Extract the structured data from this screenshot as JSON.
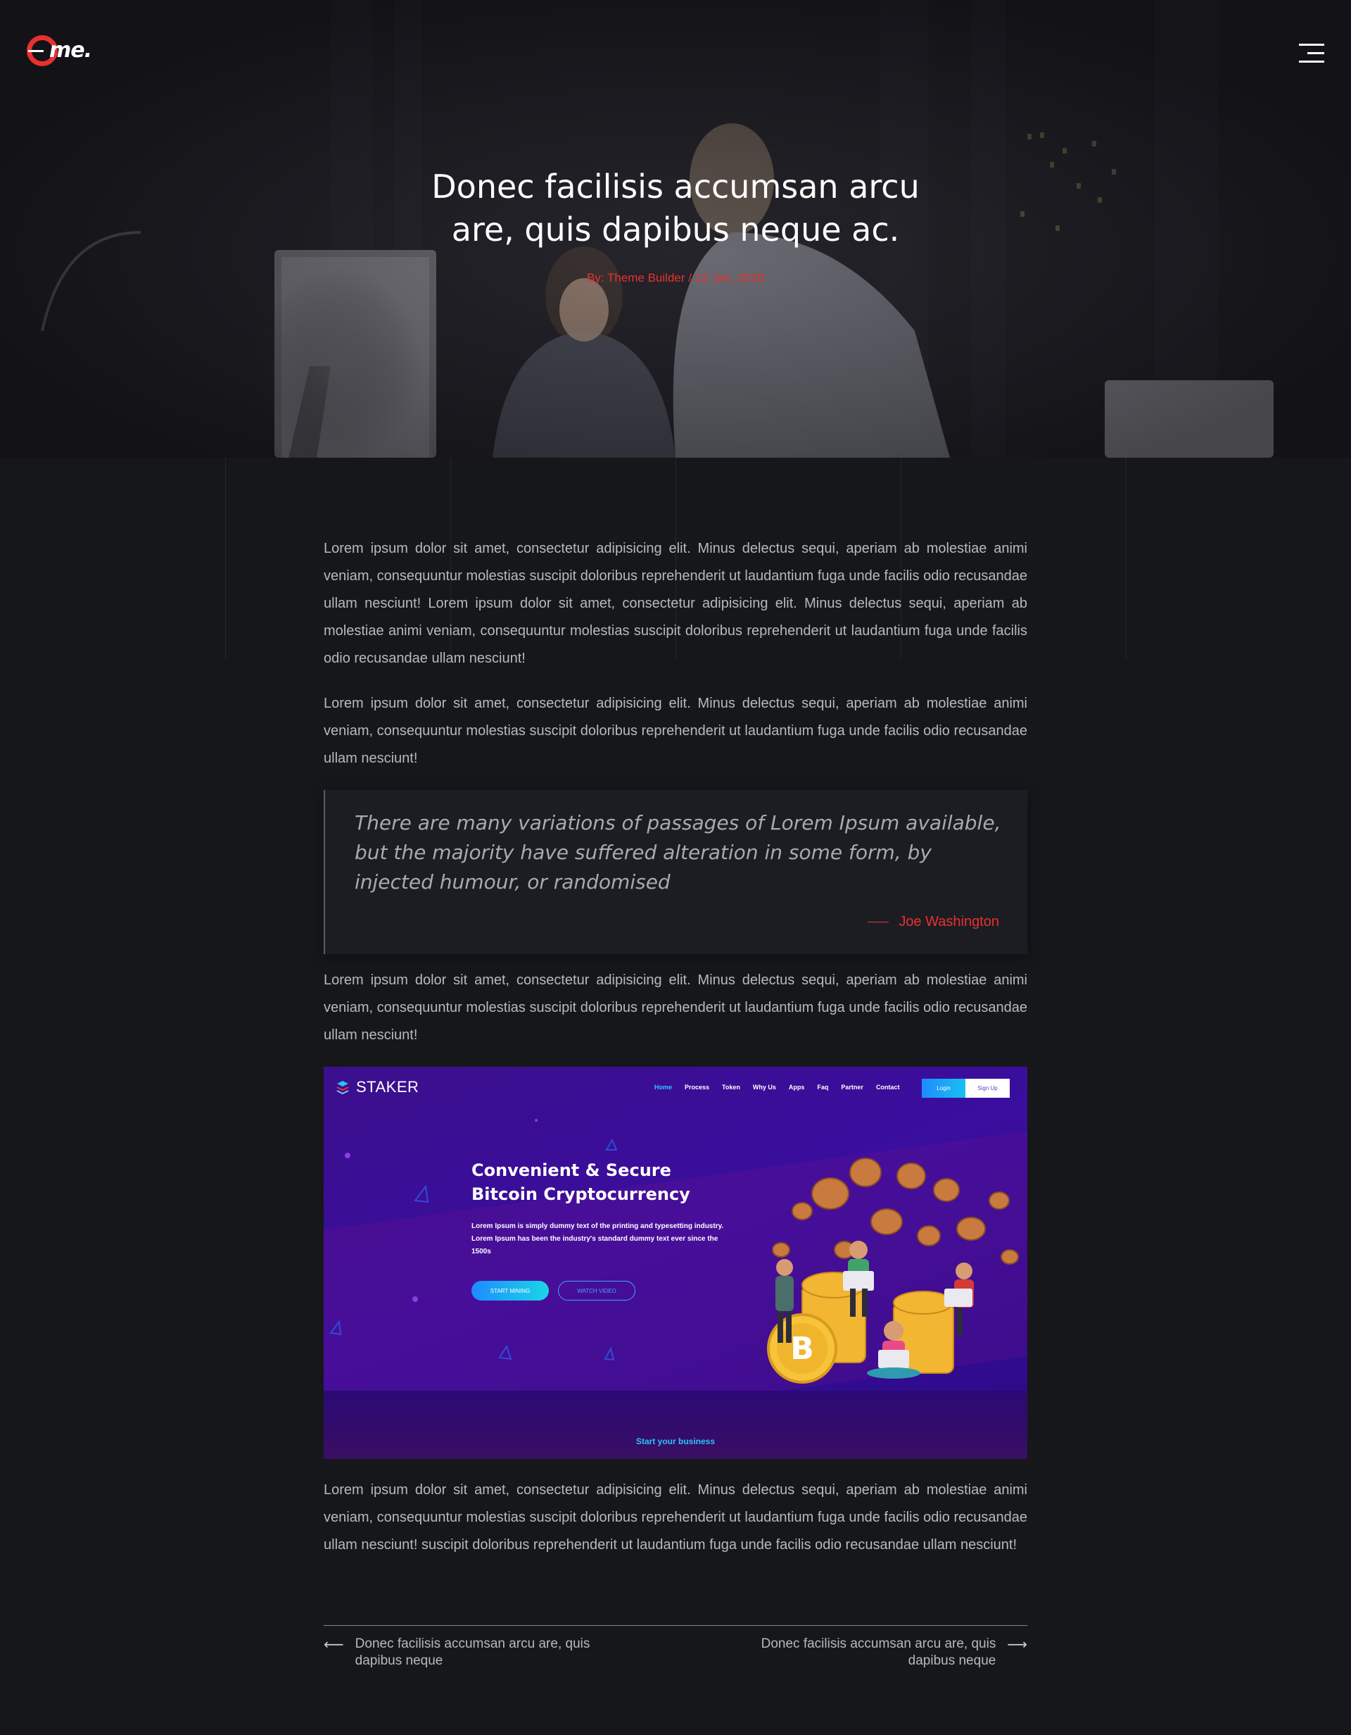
{
  "header": {
    "logo_text": "me.",
    "menu_icon": "hamburger-menu-icon"
  },
  "hero": {
    "title_line1": "Donec facilisis accumsan arcu",
    "title_line2": "are, quis dapibus neque ac.",
    "meta": "By: Theme Builder / 12 Jan, 2020"
  },
  "article": {
    "paragraph1": "Lorem ipsum dolor sit amet, consectetur adipisicing elit. Minus delectus sequi, aperiam ab molestiae animi veniam, consequuntur molestias suscipit doloribus reprehenderit ut laudantium fuga unde facilis odio recusandae ullam nesciunt! Lorem ipsum dolor sit amet, consectetur adipisicing elit. Minus delectus sequi, aperiam ab molestiae animi veniam, consequuntur molestias suscipit doloribus reprehenderit ut laudantium fuga unde facilis odio recusandae ullam nesciunt!",
    "paragraph2": "Lorem ipsum dolor sit amet, consectetur adipisicing elit. Minus delectus sequi, aperiam ab molestiae animi veniam, consequuntur molestias suscipit doloribus reprehenderit ut laudantium fuga unde facilis odio recusandae ullam nesciunt!",
    "quote": {
      "text": "There are many variations of passages of Lorem Ipsum available, but the majority have suffered alteration in some form, by injected humour, or randomised",
      "author": "Joe Washington"
    },
    "paragraph3": "Lorem ipsum dolor sit amet, consectetur adipisicing elit. Minus delectus sequi, aperiam ab molestiae animi veniam, consequuntur molestias suscipit doloribus reprehenderit ut laudantium fuga unde facilis odio recusandae ullam nesciunt!",
    "paragraph4": "Lorem ipsum dolor sit amet, consectetur adipisicing elit. Minus delectus sequi, aperiam ab molestiae animi veniam, consequuntur molestias suscipit doloribus reprehenderit ut laudantium fuga unde facilis odio recusandae ullam nesciunt! suscipit doloribus reprehenderit ut laudantium fuga unde facilis odio recusandae ullam nesciunt!"
  },
  "embedded_screenshot": {
    "logo_text": "STAKER",
    "nav": [
      "Home",
      "Process",
      "Token",
      "Why Us",
      "Apps",
      "Faq",
      "Partner",
      "Contact"
    ],
    "login_label": "Login",
    "signup_label": "Sign Up",
    "headline_line1": "Convenient & Secure",
    "headline_line2": "Bitcoin Cryptocurrency",
    "copy": "Lorem Ipsum is simply dummy text of the printing and typesetting industry. Lorem Ipsum has been the industry's standard dummy text ever since the 1500s",
    "cta_primary": "START MINING",
    "cta_secondary": "WATCH VIDEO",
    "subheading": "Start your business",
    "bitcoin_icon": "bitcoin-coin-icon"
  },
  "post_nav": {
    "prev_label": "Donec facilisis accumsan arcu are, quis dapibus neque",
    "next_label": "Donec facilisis accumsan arcu are, quis dapibus neque",
    "prev_icon": "arrow-left-icon",
    "next_icon": "arrow-right-icon"
  },
  "colors": {
    "background": "#16171b",
    "accent": "#e8312f",
    "text": "#b8b9bd",
    "heading": "#ffffff"
  }
}
